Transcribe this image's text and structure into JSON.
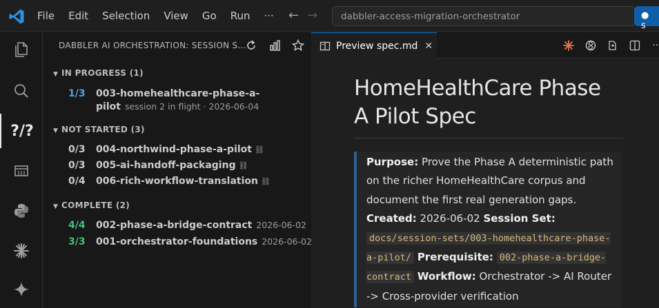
{
  "menu": [
    "File",
    "Edit",
    "Selection",
    "View",
    "Go",
    "Run",
    "···"
  ],
  "command_center": {
    "text": "dabbler-access-migration-orchestrator",
    "right_label": "● s"
  },
  "sidebar": {
    "title": "DABBLER AI ORCHESTRATION: SESSION S...",
    "sections": [
      {
        "label": "IN PROGRESS (1)",
        "items": [
          {
            "progress": "1/3",
            "name_line1": "003-homehealthcare-phase-a-",
            "name_line2": "pilot",
            "meta": "session 2 in flight · 2026-06-04",
            "status": "in-progress"
          }
        ]
      },
      {
        "label": "NOT STARTED (3)",
        "items": [
          {
            "progress": "0/3",
            "name": "004-northwind-phase-a-pilot",
            "link": "⛓"
          },
          {
            "progress": "0/3",
            "name": "005-ai-handoff-packaging",
            "link": "⛓"
          },
          {
            "progress": "0/4",
            "name": "006-rich-workflow-translation",
            "link": "⛓"
          }
        ]
      },
      {
        "label": "COMPLETE (2)",
        "items": [
          {
            "progress": "4/4",
            "name": "002-phase-a-bridge-contract",
            "meta": "2026-06-02"
          },
          {
            "progress": "3/3",
            "name": "001-orchestrator-foundations",
            "meta": "2026-06-02"
          }
        ]
      }
    ]
  },
  "editor": {
    "tab_label": "Preview spec.md",
    "tab_close": "✕",
    "doc": {
      "title_line1": "HomeHealthCare Phase",
      "title_line2": "A Pilot Spec",
      "purpose_label": "Purpose:",
      "purpose_text": " Prove the Phase A deterministic path on the richer HomeHealthCare corpus and document the first real generation gaps.",
      "created_label": "Created:",
      "created_value": " 2026-06-02 ",
      "session_set_label": "Session Set:",
      "session_set_value": "docs/session-sets/003-homehealthcare-phase-a-pilot/",
      "prerequisite_label": "Prerequisite:",
      "prerequisite_value": "002-phase-a-bridge-contract",
      "workflow_label": "Workflow:",
      "workflow_value": " Orchestrator -> AI Router -> Cross-provider verification"
    }
  },
  "colors": {
    "accent": "#0078d4",
    "in_progress": "#4fa6e8",
    "complete": "#3fc07a",
    "quote_border": "#2f5f95"
  }
}
